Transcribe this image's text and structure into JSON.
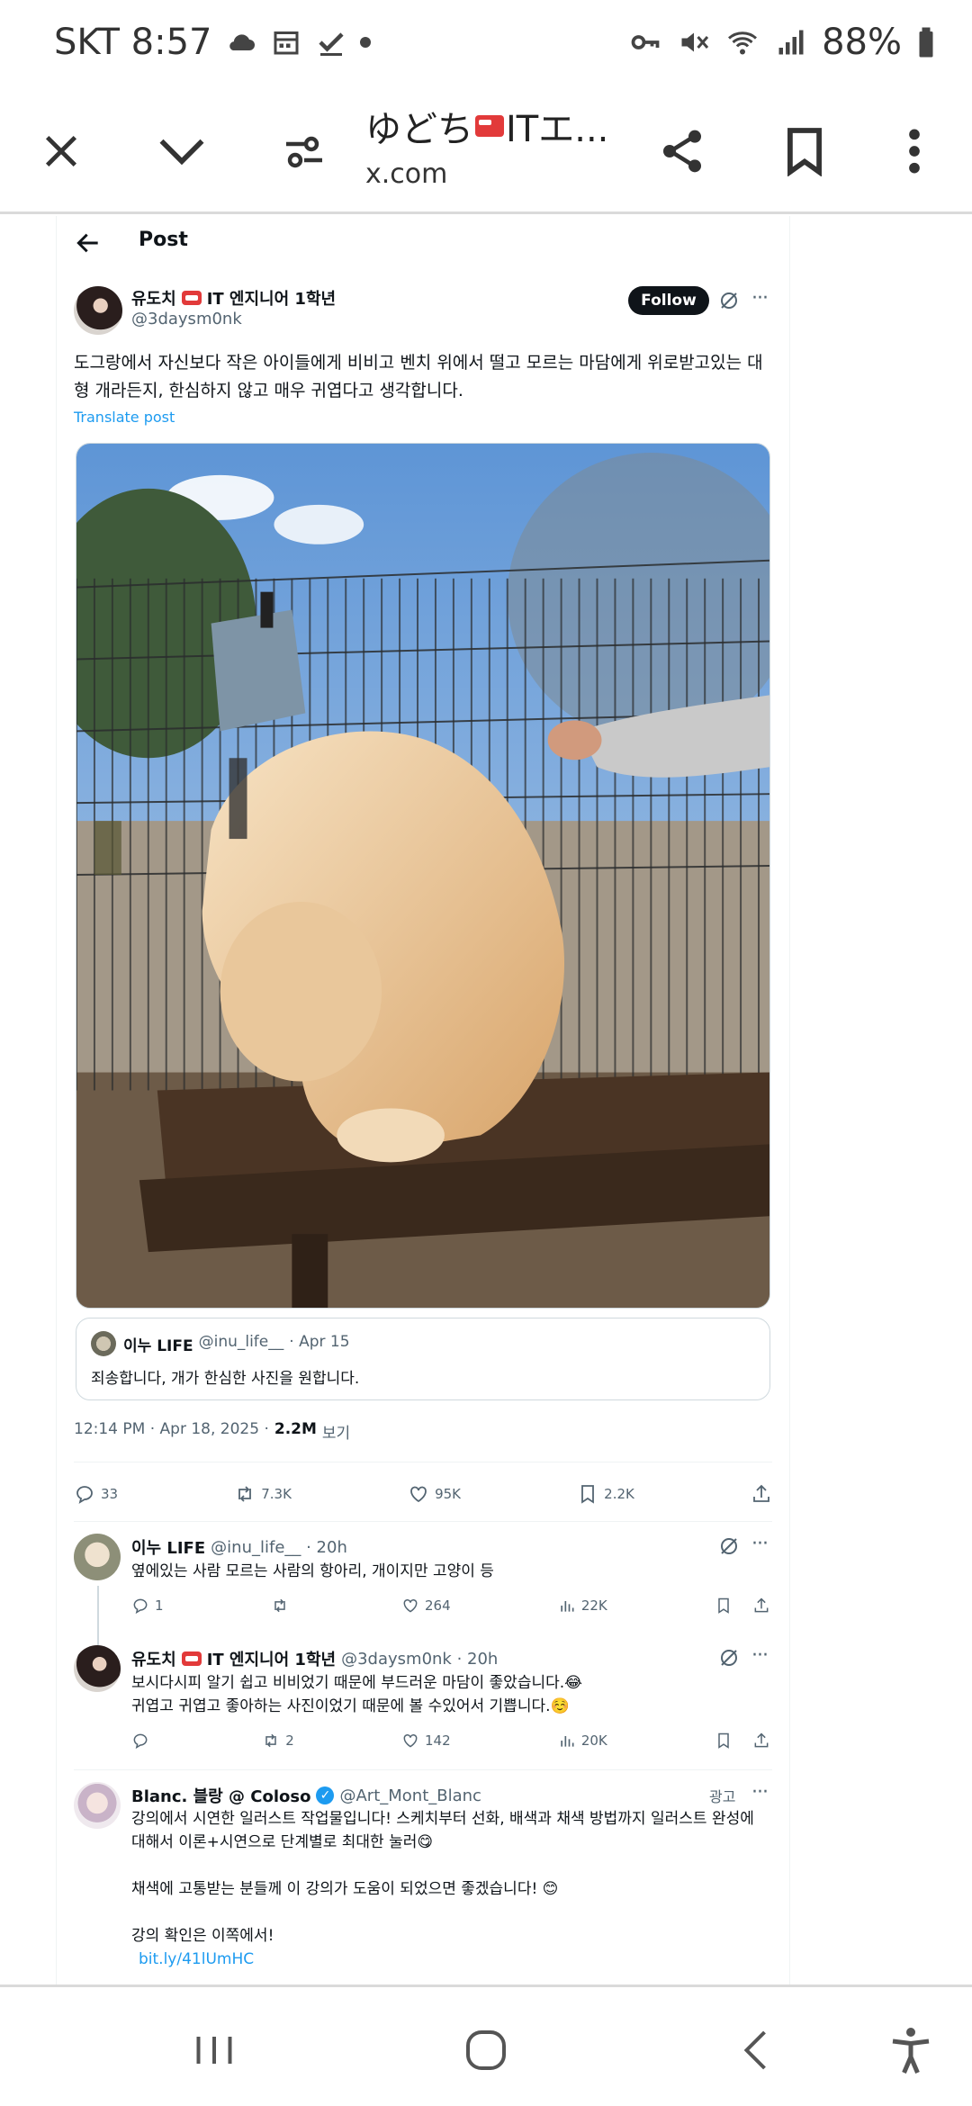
{
  "status_bar": {
    "carrier_time": "SKT 8:57",
    "battery": "88%"
  },
  "tab_bar": {
    "title": "ゆどち",
    "title_suffix": "ITエ...",
    "url": "x.com"
  },
  "post_header": {
    "title": "Post"
  },
  "tweet": {
    "author_name": "유도치",
    "author_name_suffix": "IT 엔지니어 1학년",
    "handle": "@3daysm0nk",
    "follow_label": "Follow",
    "text": "도그랑에서 자신보다 작은 아이들에게 비비고 벤치 위에서 떨고 모르는 마담에게 위로받고있는 대형 개라든지, 한심하지 않고 매우 귀엽다고 생각합니다.",
    "translate": "Translate post",
    "quote": {
      "name": "이누 LIFE",
      "handle": "@inu_life__",
      "date": "· Apr 15",
      "text": "죄송합니다, 개가 한심한 사진을 원합니다."
    },
    "timestamp": "12:14 PM · Apr 18, 2025 ·",
    "views": "2.2M",
    "views_label": "보기",
    "counts": {
      "replies": "33",
      "reposts": "7.3K",
      "likes": "95K",
      "bookmarks": "2.2K"
    }
  },
  "replies": [
    {
      "name": "이누 LIFE",
      "handle": "@inu_life__ · 20h",
      "text": "옆에있는 사람 모르는 사람의 항아리, 개이지만 고양이 등",
      "replies": "1",
      "reposts": "",
      "likes": "264",
      "views": "22K"
    },
    {
      "name": "유도치",
      "name_suffix": "IT 엔지니어 1학년",
      "handle": "@3daysm0nk · 20h",
      "text_line1": "보시다시피 알기 쉽고 비비었기 때문에 부드러운 마담이 좋았습니다.😂",
      "text_line2": "귀엽고 귀엽고 좋아하는 사진이었기 때문에 볼 수있어서 기쁩니다.☺️",
      "replies": "",
      "reposts": "2",
      "likes": "142",
      "views": "20K"
    }
  ],
  "ad": {
    "name": "Blanc. 블랑 @ Coloso",
    "handle": "@Art_Mont_Blanc",
    "label": "광고",
    "line1": "강의에서 시연한 일러스트 작업물입니다! 스케치부터 선화, 배색과 채색 방법까지 일러스트 완성에 대해서 이론+시연으로 단계별로 최대한 눌러😋",
    "line2": "채색에 고통받는 분들께 이 강의가 도움이 되었으면 좋겠습니다! 😊",
    "line3": "강의 확인은 이쪽에서!",
    "link": "bit.ly/41lUmHC"
  },
  "colors": {
    "accent": "#1d9bf0",
    "text": "#0f1419",
    "muted": "#536471"
  }
}
